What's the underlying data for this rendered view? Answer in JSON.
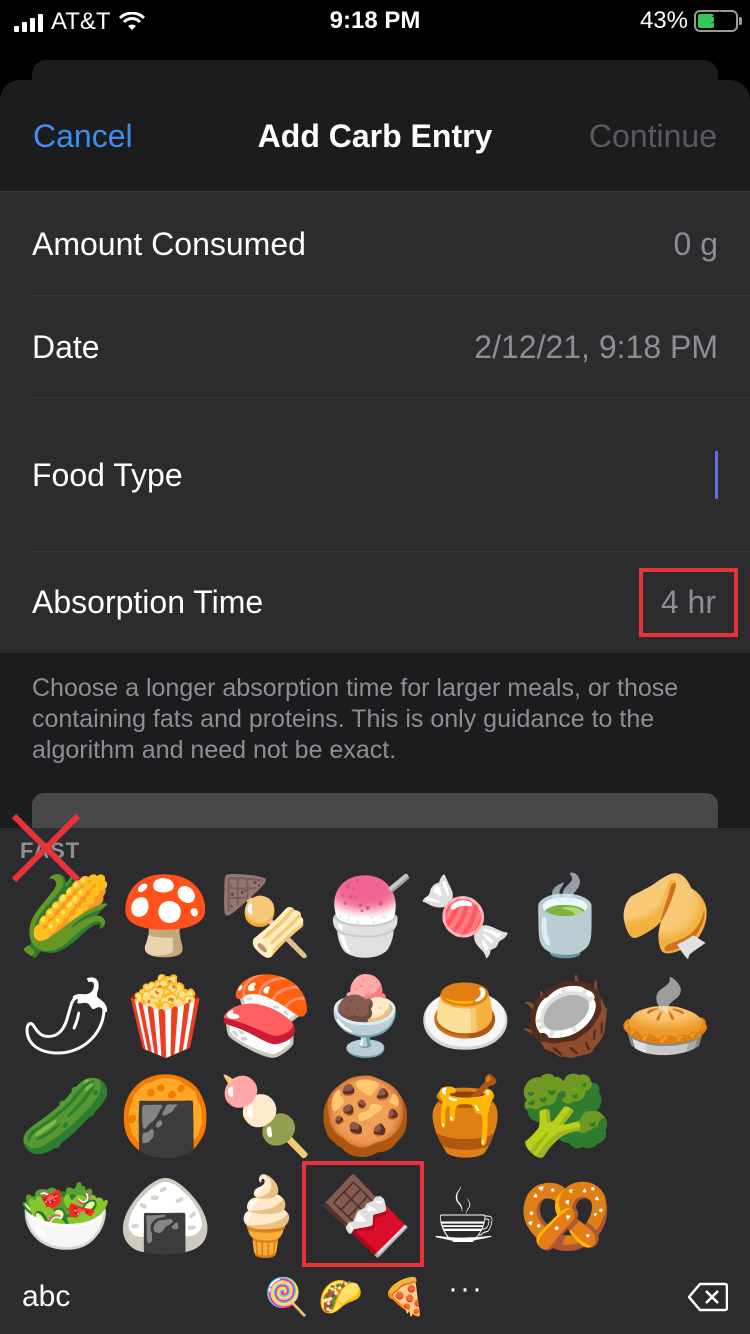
{
  "status_bar": {
    "carrier": "AT&T",
    "time": "9:18 PM",
    "battery": "43%"
  },
  "nav": {
    "cancel": "Cancel",
    "title": "Add Carb Entry",
    "continue": "Continue"
  },
  "rows": [
    {
      "label": "Amount Consumed",
      "value": "0 g"
    },
    {
      "label": "Date",
      "value": "2/12/21, 9:18 PM"
    },
    {
      "label": "Food Type",
      "value": ""
    },
    {
      "label": "Absorption Time",
      "value": "4 hr"
    }
  ],
  "footer": "Choose a longer absorption time for larger meals, or those containing fats and proteins. This is only guidance to the algorithm and need not be exact.",
  "keyboard": {
    "section_label": "FAST",
    "emojis": [
      [
        "🌽",
        "🍄",
        "🍢",
        "🍧",
        "🍬",
        "🍵",
        "🥠"
      ],
      [
        "🌶",
        "🍿",
        "🍣",
        "🍨",
        "🍮",
        "🥥",
        "🥧"
      ],
      [
        "🥒",
        "🍘",
        "🍡",
        "🍪",
        "🍯",
        "🥦"
      ],
      [
        "🥗",
        "🍙",
        "🍦",
        "🍫",
        "☕",
        "🥨"
      ]
    ],
    "abc": "abc",
    "categories": [
      "🍭",
      "🌮",
      "🍕"
    ],
    "more": "···"
  },
  "colors": {
    "accent": "#3e8ef0",
    "highlight": "#e8333c"
  }
}
